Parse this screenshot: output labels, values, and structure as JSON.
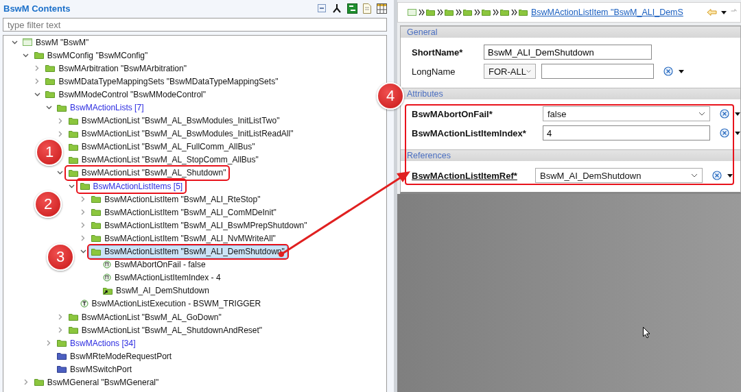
{
  "left_panel": {
    "title": "BswM Contents",
    "filter": {
      "placeholder": "type filter text"
    },
    "tree": [
      {
        "kind": "root",
        "label": "BswM \"BswM\"",
        "expanded": true,
        "selected": false,
        "children": [
          {
            "kind": "container",
            "label": "BswMConfig \"BswMConfig\"",
            "expanded": true,
            "selected": false,
            "children": [
              {
                "kind": "container",
                "label": "BswMArbitration \"BswMArbitration\"",
                "expanded": false,
                "selected": false
              },
              {
                "kind": "container",
                "label": "BswMDataTypeMappingSets \"BswMDataTypeMappingSets\"",
                "expanded": false,
                "selected": false
              },
              {
                "kind": "container",
                "label": "BswMModeControl \"BswMModeControl\"",
                "expanded": true,
                "selected": false,
                "children": [
                  {
                    "kind": "collection",
                    "label": "BswMActionLists [7]",
                    "expanded": true,
                    "selected": false,
                    "children": [
                      {
                        "kind": "container",
                        "label": "BswMActionList \"BswM_AL_BswModules_InitListTwo\"",
                        "expanded": false,
                        "selected": false
                      },
                      {
                        "kind": "container",
                        "label": "BswMActionList \"BswM_AL_BswModules_InitListReadAll\"",
                        "expanded": false,
                        "selected": false
                      },
                      {
                        "kind": "container",
                        "label": "BswMActionList \"BswM_AL_FullComm_AllBus\"",
                        "selected": false
                      },
                      {
                        "kind": "container",
                        "label": "BswMActionList \"BswM_AL_StopComm_AllBus\"",
                        "selected": false
                      },
                      {
                        "kind": "container",
                        "label": "BswMActionList \"BswM_AL_Shutdown\"",
                        "expanded": true,
                        "selected": false,
                        "outlined": true,
                        "children": [
                          {
                            "kind": "collection",
                            "label": "BswMActionListItems [5]",
                            "expanded": true,
                            "selected": false,
                            "outlined": true,
                            "children": [
                              {
                                "kind": "container",
                                "label": "BswMActionListItem \"BswM_ALI_RteStop\"",
                                "expanded": false,
                                "selected": false
                              },
                              {
                                "kind": "container",
                                "label": "BswMActionListItem \"BswM_ALI_ComMDeInit\"",
                                "expanded": false,
                                "selected": false
                              },
                              {
                                "kind": "container",
                                "label": "BswMActionListItem \"BswM_ALI_BswMPrepShutdown\"",
                                "expanded": false,
                                "selected": false
                              },
                              {
                                "kind": "container",
                                "label": "BswMActionListItem \"BswM_ALI_NvMWriteAll\"",
                                "expanded": false,
                                "selected": false
                              },
                              {
                                "kind": "container",
                                "label": "BswMActionListItem \"BswM_ALI_DemShutdown\"",
                                "expanded": true,
                                "selected": true,
                                "outlined": true,
                                "children": [
                                  {
                                    "kind": "param",
                                    "label": "BswMAbortOnFail - false",
                                    "selected": false
                                  },
                                  {
                                    "kind": "param",
                                    "label": "BswMActionListItemIndex - 4",
                                    "selected": false
                                  },
                                  {
                                    "kind": "reference",
                                    "label": "BswM_AI_DemShutdown",
                                    "selected": false
                                  }
                                ]
                              }
                            ]
                          },
                          {
                            "kind": "enum",
                            "label": "BswMActionListExecution - BSWM_TRIGGER",
                            "selected": false
                          }
                        ]
                      },
                      {
                        "kind": "container",
                        "label": "BswMActionList \"BswM_AL_GoDown\"",
                        "expanded": false,
                        "selected": false
                      },
                      {
                        "kind": "container",
                        "label": "BswMActionList \"BswM_AL_ShutdownAndReset\"",
                        "expanded": false,
                        "selected": false
                      }
                    ]
                  },
                  {
                    "kind": "collection",
                    "label": "BswMActions [34]",
                    "expanded": false,
                    "selected": false
                  },
                  {
                    "kind": "port",
                    "label": "BswMRteModeRequestPort",
                    "selected": false
                  },
                  {
                    "kind": "port",
                    "label": "BswMSwitchPort",
                    "selected": false
                  }
                ]
              }
            ]
          },
          {
            "kind": "container",
            "label": "BswMGeneral \"BswMGeneral\"",
            "expanded": false,
            "selected": false
          }
        ]
      }
    ]
  },
  "right_panel": {
    "breadcrumb": {
      "link": "BswMActionListItem \"BswM_ALI_DemS"
    },
    "sections": [
      {
        "title": "General",
        "fields": [
          {
            "kind": "text",
            "label": "ShortName*",
            "required": true,
            "value": "BswM_ALI_DemShutdown",
            "reset_button": false
          },
          {
            "kind": "longname",
            "label": "LongName",
            "required": false,
            "language": "FOR-ALL",
            "reset_button": true
          }
        ]
      },
      {
        "title": "Attributes",
        "fields": [
          {
            "kind": "choice",
            "label": "BswMAbortOnFail*",
            "required": true,
            "value": "false",
            "reset_button": true
          },
          {
            "kind": "text",
            "label": "BswMActionListItemIndex*",
            "required": true,
            "value": "4",
            "reset_button": true
          }
        ]
      },
      {
        "title": "References",
        "fields": [
          {
            "kind": "reference",
            "label": "BswMActionListItemRef*",
            "required": true,
            "value": "BswM_AI_DemShutdown",
            "reset_button": true
          }
        ]
      }
    ],
    "outlined": true
  },
  "annotations": [
    {
      "number": "1"
    },
    {
      "number": "2"
    },
    {
      "number": "3"
    },
    {
      "number": "4"
    }
  ]
}
